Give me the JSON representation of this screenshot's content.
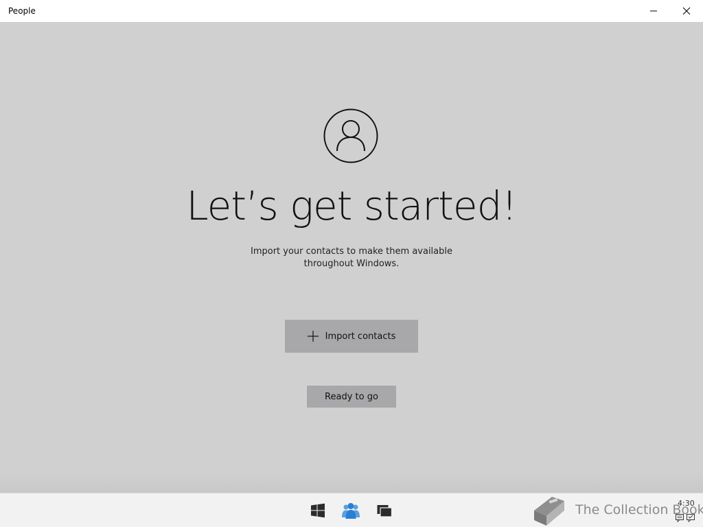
{
  "window": {
    "title": "People"
  },
  "main": {
    "headline": "Let’s get started!",
    "subtitle": "Import your contacts to make them available throughout Windows.",
    "import_button_label": "Import contacts",
    "ready_button_label": "Ready to go"
  },
  "taskbar": {
    "icons": [
      "windows-start-icon",
      "people-icon",
      "task-view-icon"
    ],
    "clock": "4:30"
  },
  "watermark": {
    "text": "The Collection Book"
  },
  "colors": {
    "background": "#d0d0d0",
    "button": "#a8a8aa",
    "accent": "#2a7fd4"
  }
}
